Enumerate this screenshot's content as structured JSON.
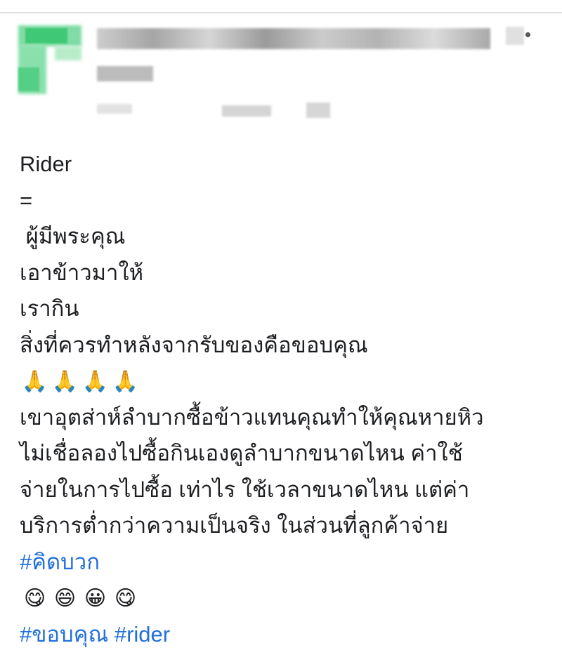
{
  "post": {
    "lines": [
      "Rider",
      "=",
      " ผู้มีพระคุณ",
      "เอาข้าวมาให้",
      "เรากิน",
      "สิ่งที่ควรทำหลังจากรับของคือขอบคุณ"
    ],
    "praying_emojis": [
      "🙏",
      "🙏",
      "🙏",
      "🙏"
    ],
    "paragraph": [
      "เขาอุตส่าห์ลำบากซื้อข้าวแทนคุณทำให้คุณหายหิว",
      "ไม่เชื่อลองไปซื้อกินเองดูลำบากขนาดไหน ค่าใช้",
      "จ่ายในการไปซื้อ เท่าไร ใช้เวลาขนาดไหน แต่ค่า",
      "บริการต่ำกว่าความเป็นจริง ในส่วนที่ลูกค้าจ่าย"
    ],
    "hashtag_1": "#คิดบวก",
    "smile_emojis": [
      "😋",
      "😄",
      "😀",
      "😋"
    ],
    "hashtag_2": "#ขอบคุณ",
    "hashtag_3": "#rider"
  },
  "icons": {
    "avatar": "blurred-avatar",
    "menu": "more-options-icon"
  },
  "colors": {
    "hashtag": "#216fdb",
    "text": "#1c1e21",
    "avatar_green": "#3fc876"
  }
}
